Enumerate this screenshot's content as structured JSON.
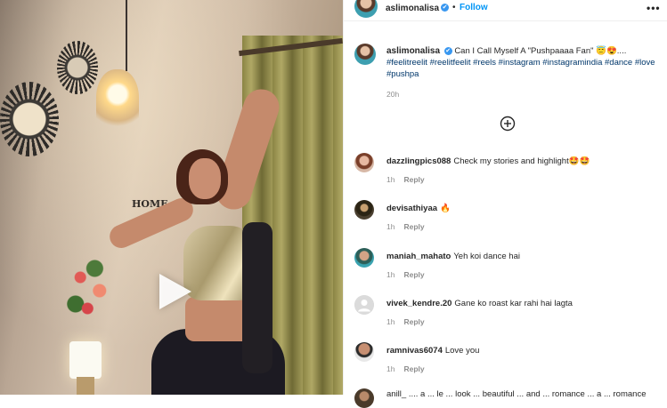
{
  "post": {
    "username": "aslimonalisa",
    "verified_glyph": "✔",
    "separator": "•",
    "follow_label": "Follow",
    "more_label": "•••"
  },
  "caption": {
    "username": "aslimonalisa",
    "text": "Can I Call Myself A \"Pushpaaaa Fan\" 😇😍....",
    "hashtags": "#feelitreelit #reelitfeelit #reels #instagram #instagramindia #dance #love #pushpa",
    "time": "20h"
  },
  "media": {
    "home_sign": "HOME",
    "play_icon": "play-icon"
  },
  "load_more_icon": "plus-circle-icon",
  "comments": [
    {
      "username": "dazzlingpics088",
      "text": "Check my stories and highlight🤩🤩",
      "time": "1h",
      "reply": "Reply"
    },
    {
      "username": "devisathiyaa",
      "text": "🔥",
      "time": "1h",
      "reply": "Reply"
    },
    {
      "username": "maniah_mahato",
      "text": "Yeh koi dance hai",
      "time": "1h",
      "reply": "Reply"
    },
    {
      "username": "vivek_kendre.20",
      "text": "Gane ko roast kar rahi hai lagta",
      "time": "1h",
      "reply": "Reply"
    },
    {
      "username": "ramnivas6074",
      "text": "Love you",
      "time": "1h",
      "reply": "Reply"
    }
  ],
  "partial_comment": "anill_ .... a ... le ... look ... beautiful ... and ... romance ... a ... romance"
}
